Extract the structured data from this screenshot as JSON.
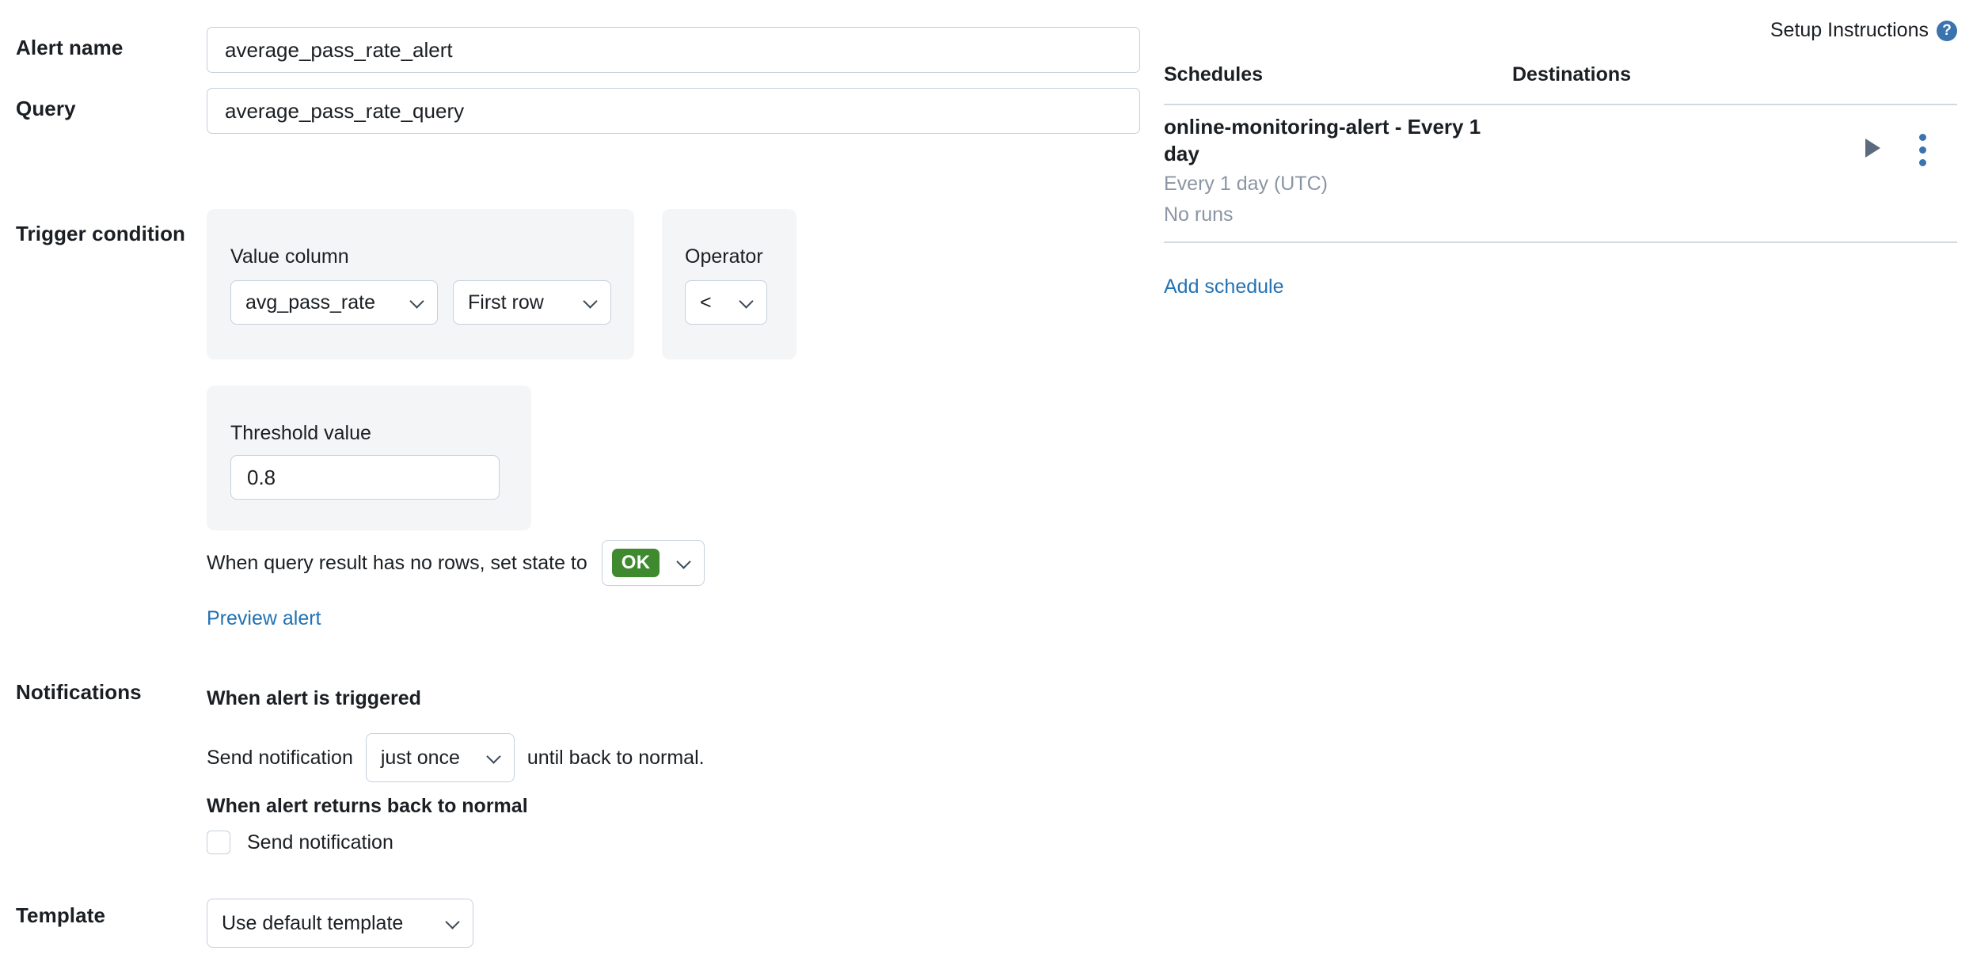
{
  "form": {
    "alert_name": {
      "label": "Alert name",
      "value": "average_pass_rate_alert"
    },
    "query": {
      "label": "Query",
      "value": "average_pass_rate_query"
    },
    "trigger_condition": {
      "label": "Trigger condition",
      "value_column": {
        "label": "Value column",
        "column_select": "avg_pass_rate",
        "aggregation_select": "First row"
      },
      "operator": {
        "label": "Operator",
        "value": "<"
      },
      "threshold": {
        "label": "Threshold value",
        "value": "0.8"
      },
      "no_rows_rule": {
        "text": "When query result has no rows, set state to",
        "state": "OK"
      },
      "preview_link": "Preview alert"
    },
    "notifications": {
      "label": "Notifications",
      "when_triggered_heading": "When alert is triggered",
      "send_notification_prefix": "Send notification",
      "frequency": "just once",
      "send_notification_suffix": "until back to normal.",
      "when_normal_heading": "When alert returns back to normal",
      "normal_checkbox_label": "Send notification",
      "normal_checkbox_checked": false
    },
    "template": {
      "label": "Template",
      "value": "Use default template"
    }
  },
  "right_panel": {
    "setup_instructions": "Setup Instructions",
    "help_icon": "help-circle-icon",
    "columns": {
      "schedules": "Schedules",
      "destinations": "Destinations"
    },
    "schedule_row": {
      "title": "online-monitoring-alert - Every 1 day",
      "cadence": "Every 1 day (UTC)",
      "runs": "No runs",
      "run_icon": "play-icon",
      "menu_icon": "kebab-menu-icon"
    },
    "add_schedule_link": "Add schedule"
  },
  "colors": {
    "link": "#2272b4",
    "ok_badge": "#3f8a2e",
    "panel": "#f4f5f7",
    "border": "#c5d0de",
    "rule": "#d3d9e3",
    "muted_text": "#8a95a3"
  }
}
